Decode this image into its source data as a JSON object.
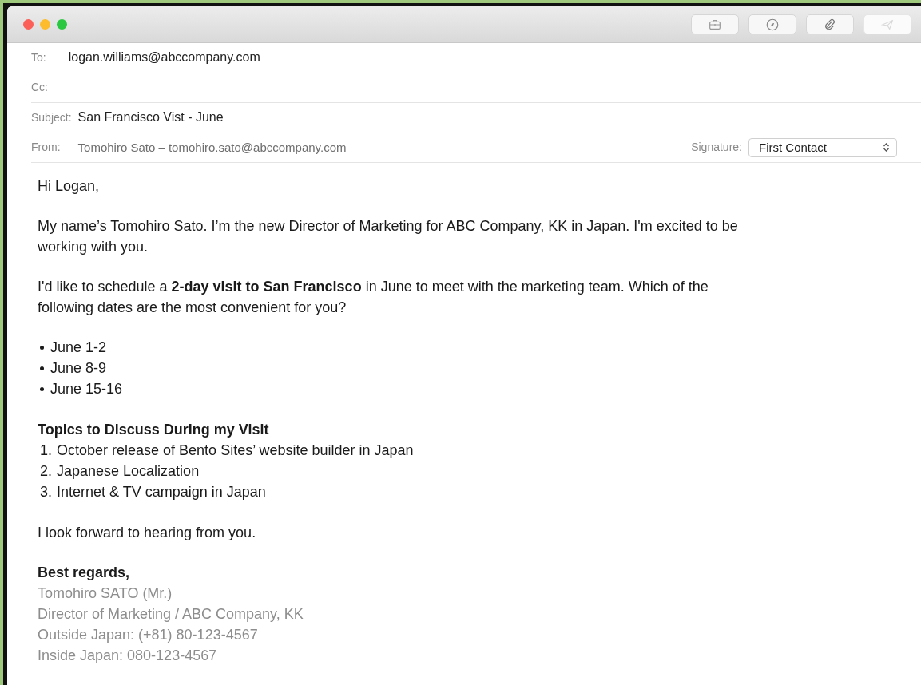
{
  "window": {
    "toolbar": [
      {
        "kind": "briefcase",
        "disabled": false
      },
      {
        "kind": "compass",
        "disabled": false
      },
      {
        "kind": "paperclip",
        "disabled": false
      },
      {
        "kind": "send",
        "disabled": true
      }
    ]
  },
  "header": {
    "to": {
      "label": "To:",
      "value": "logan.williams@abccompany.com"
    },
    "cc": {
      "label": "Cc:"
    },
    "subject": {
      "label": "Subject:",
      "value": "San Francisco Vist - June"
    },
    "from": {
      "label": "From:",
      "value": "Tomohiro Sato – tomohiro.sato@abccompany.com"
    },
    "signature": {
      "label": "Signature:",
      "value": "First Contact"
    }
  },
  "body": [
    {
      "kind": "paragraph",
      "text": "Hi Logan,"
    },
    {
      "kind": "paragraph",
      "text": "My name’s Tomohiro Sato. I’m the new Director of Marketing for ABC Company, KK in Japan. I'm excited to be working with you."
    },
    {
      "kind": "paragraph",
      "text": "I'd like to schedule a **2-day visit to San Francisco** in June to meet with the marketing team. Which of the following dates are the most convenient for you?"
    },
    {
      "kind": "bullets",
      "items": [
        "June 1-2",
        "June 8-9",
        "June 15-16"
      ]
    },
    {
      "kind": "numbered",
      "heading": "Topics to Discuss During my Visit",
      "items": [
        {
          "number": "1.",
          "text": "October release of Bento Sites’ website builder in Japan"
        },
        {
          "number": "2.",
          "text": "Japanese Localization"
        },
        {
          "number": "3.",
          "text": "Internet & TV campaign in Japan"
        }
      ]
    },
    {
      "kind": "paragraph",
      "text": "I look forward to hearing from you."
    },
    {
      "kind": "signature",
      "closing": "Best regards,",
      "lines": [
        "Tomohiro SATO (Mr.)",
        "Director of Marketing / ABC Company, KK",
        "Outside Japan: (+81) 80-123-4567",
        "Inside Japan: 080-123-4567"
      ]
    }
  ]
}
